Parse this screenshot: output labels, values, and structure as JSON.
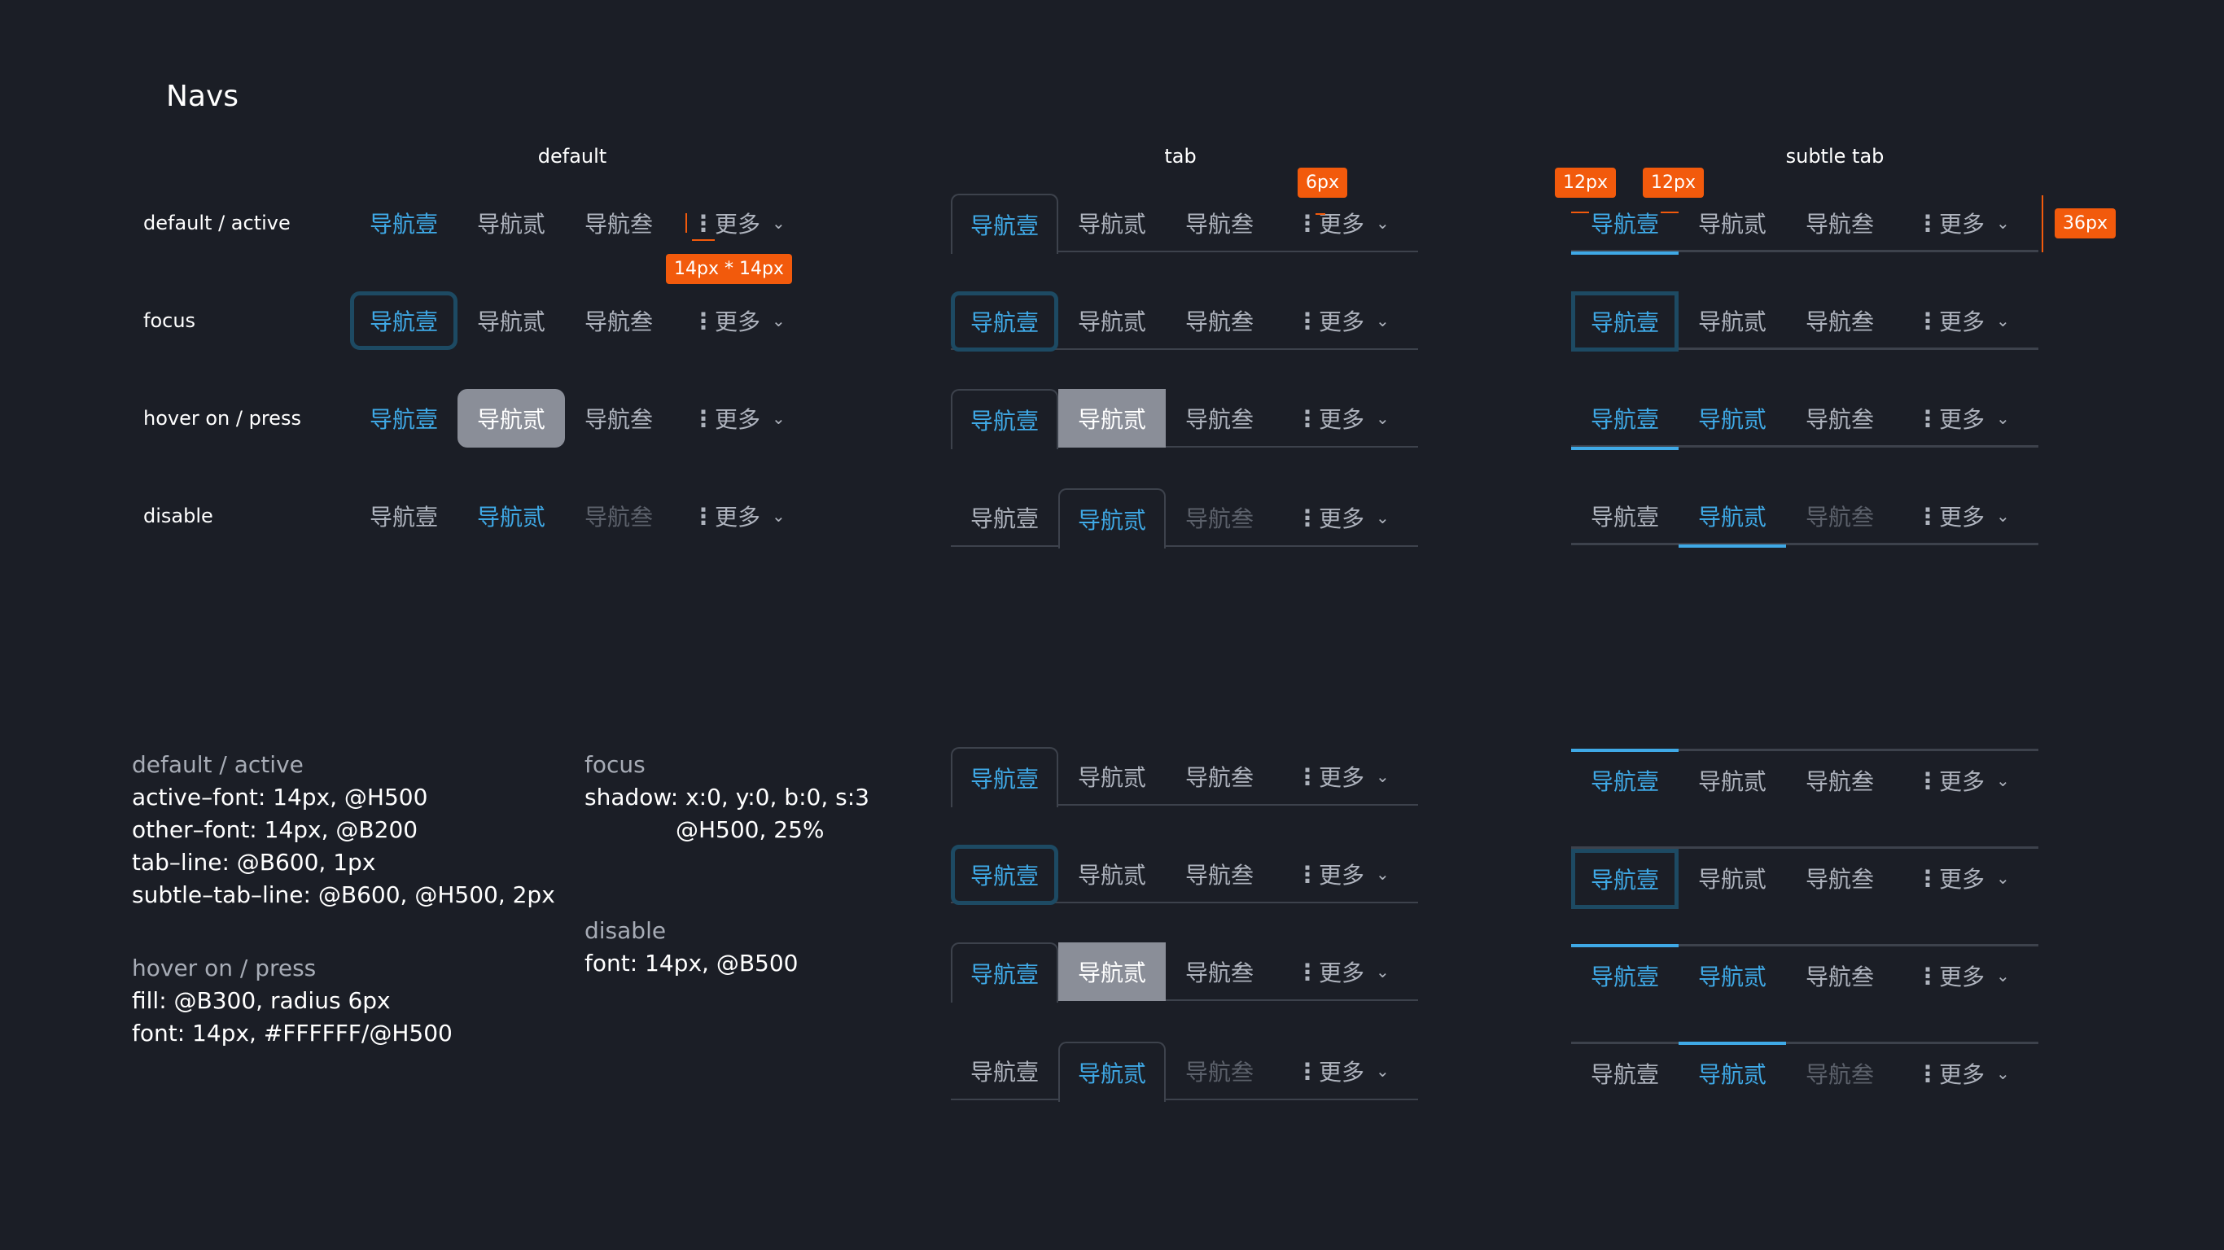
{
  "page_title": "Navs",
  "columns": {
    "default": "default",
    "tab": "tab",
    "subtle": "subtle tab"
  },
  "rows": {
    "r1": "default / active",
    "r2": "focus",
    "r3": "hover on / press",
    "r4": "disable"
  },
  "nav_items": {
    "one": "导航壹",
    "two": "导航贰",
    "three": "导航叁",
    "more": "更多",
    "dots": "⋮",
    "chevron": "⌄"
  },
  "annotations": {
    "size_14": "14px * 14px",
    "gap_6": "6px",
    "pad_12a": "12px",
    "pad_12b": "12px",
    "height_36": "36px"
  },
  "specs": {
    "default_active": {
      "head": "default / active",
      "lines": [
        "active–font: 14px, @H500",
        "other–font: 14px, @B200",
        "tab–line: @B600, 1px",
        "subtle–tab–line: @B600, @H500, 2px"
      ]
    },
    "hover": {
      "head": "hover on / press",
      "lines": [
        "fill: @B300, radius 6px",
        "font: 14px, #FFFFFF/@H500"
      ]
    },
    "focus": {
      "head": "focus",
      "lines": [
        "shadow: x:0, y:0, b:0, s:3",
        "@H500, 25%"
      ]
    },
    "disable": {
      "head": "disable",
      "lines": [
        "font: 14px, @B500"
      ]
    }
  },
  "colors": {
    "background": "#1b1e26",
    "active": "#3fa9e6",
    "text": "#aeb3bd",
    "disabled": "#5c616b",
    "pressed_fill": "#8a8e98",
    "focus_ring": "#1d4a63",
    "line": "#3d424c",
    "annotation": "#f25a0c"
  }
}
